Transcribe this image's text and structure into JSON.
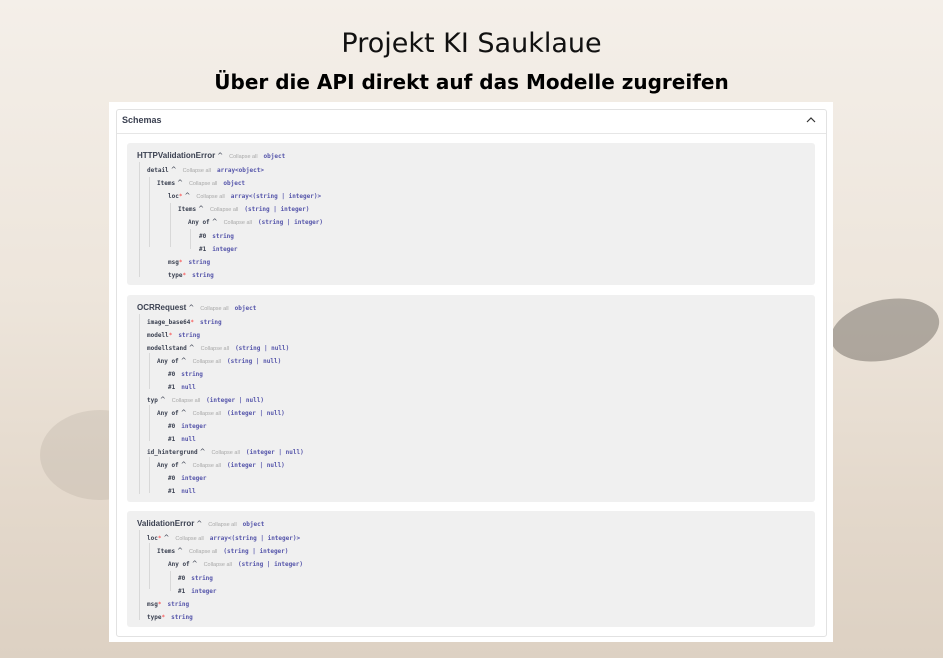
{
  "slide": {
    "title": "Projekt KI Sauklaue",
    "subtitle": "Über die API direkt auf das Modelle zugreifen"
  },
  "schemas": {
    "title": "Schemas",
    "collapse_label": "Collapse all",
    "required_mark": "*",
    "expanded_icon": "chevron-up-icon",
    "models": [
      {
        "name": "HTTPValidationError",
        "type": "object",
        "rows": [
          {
            "label": "detail",
            "type": "array<object>"
          },
          {
            "label": "Items",
            "type": "object"
          },
          {
            "label": "loc",
            "type": "array<(string | integer)>"
          },
          {
            "label": "Items",
            "type": "(string | integer)"
          },
          {
            "label": "Any of",
            "type": "(string | integer)"
          },
          {
            "label": "#0",
            "type": "string"
          },
          {
            "label": "#1",
            "type": "integer"
          },
          {
            "label": "msg",
            "type": "string"
          },
          {
            "label": "type",
            "type": "string"
          }
        ]
      },
      {
        "name": "OCRRequest",
        "type": "object",
        "rows": [
          {
            "label": "image_base64",
            "type": "string"
          },
          {
            "label": "modell",
            "type": "string"
          },
          {
            "label": "modellstand",
            "type": "(string | null)"
          },
          {
            "label": "Any of",
            "type": "(string | null)"
          },
          {
            "label": "#0",
            "type": "string"
          },
          {
            "label": "#1",
            "type": "null"
          },
          {
            "label": "typ",
            "type": "(integer | null)"
          },
          {
            "label": "Any of",
            "type": "(integer | null)"
          },
          {
            "label": "#0",
            "type": "integer"
          },
          {
            "label": "#1",
            "type": "null"
          },
          {
            "label": "id_hintergrund",
            "type": "(integer | null)"
          },
          {
            "label": "Any of",
            "type": "(integer | null)"
          },
          {
            "label": "#0",
            "type": "integer"
          },
          {
            "label": "#1",
            "type": "null"
          }
        ]
      },
      {
        "name": "ValidationError",
        "type": "object",
        "rows": [
          {
            "label": "loc",
            "type": "array<(string | integer)>"
          },
          {
            "label": "Items",
            "type": "(string | integer)"
          },
          {
            "label": "Any of",
            "type": "(string | integer)"
          },
          {
            "label": "#0",
            "type": "string"
          },
          {
            "label": "#1",
            "type": "integer"
          },
          {
            "label": "msg",
            "type": "string"
          },
          {
            "label": "type",
            "type": "string"
          }
        ]
      }
    ]
  }
}
